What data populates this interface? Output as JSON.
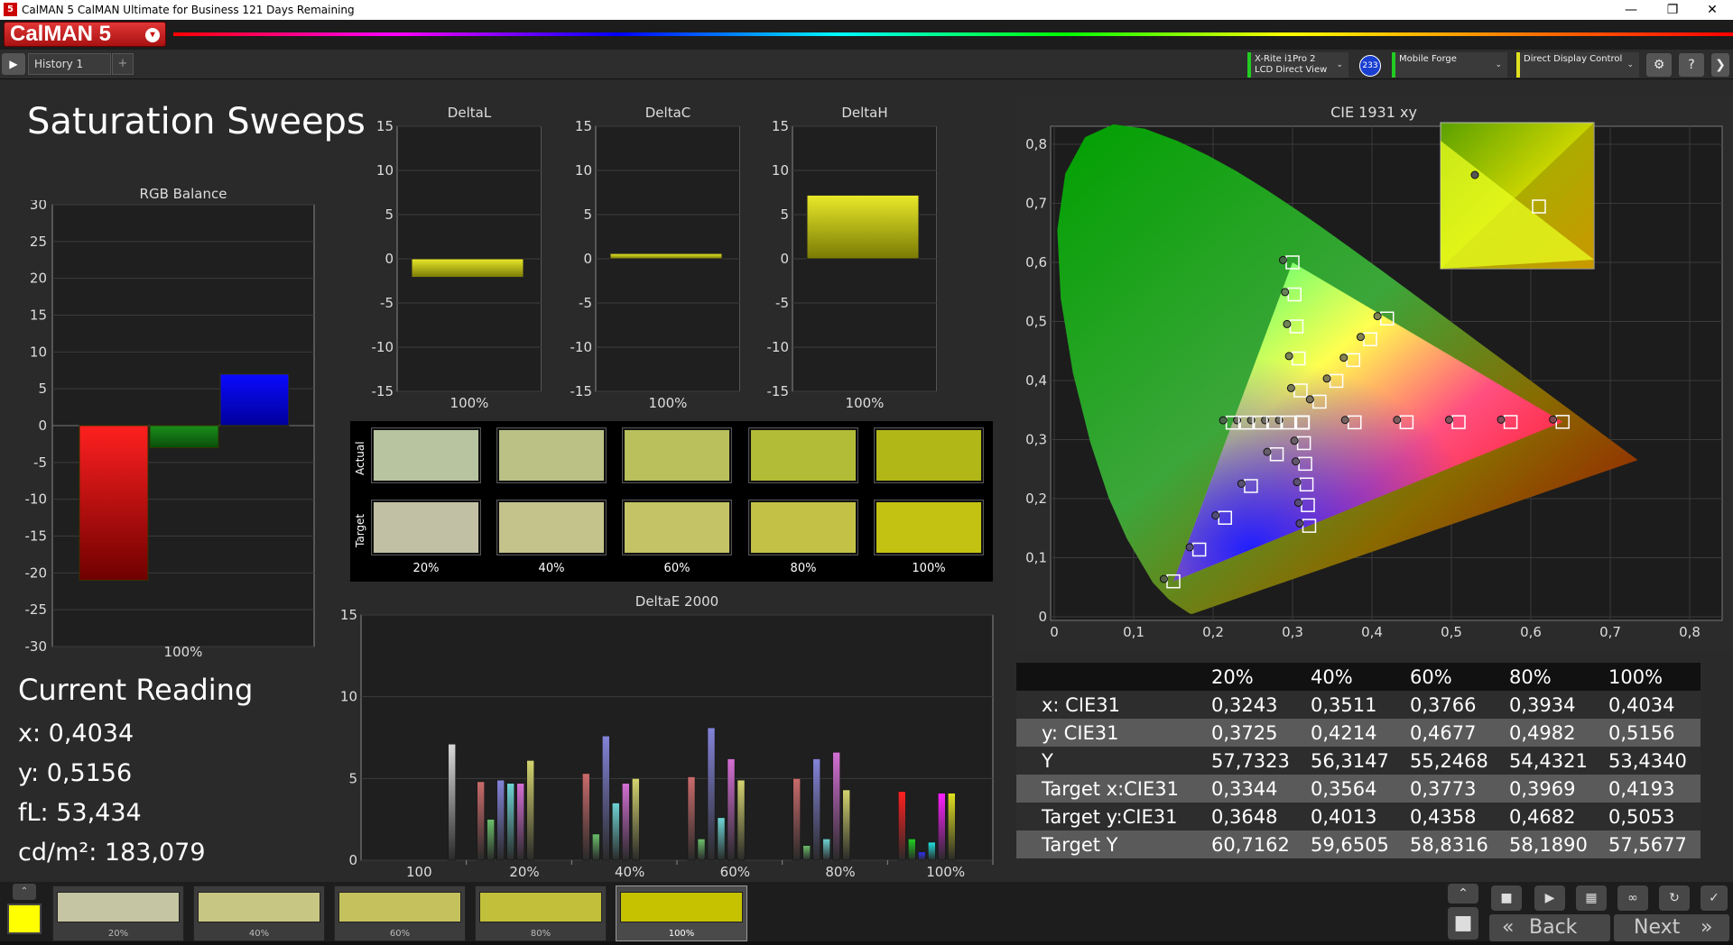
{
  "window": {
    "title": "CalMAN 5 CalMAN Ultimate for Business 121 Days Remaining",
    "app_icon": "5",
    "minimize": "—",
    "restore": "❐",
    "close": "✕"
  },
  "logo": {
    "text": "CalMAN 5",
    "menu_glyph": "▾"
  },
  "toolbar": {
    "play_glyph": "▶",
    "tab_label": "History 1",
    "add_tab_glyph": "+",
    "meter": {
      "line1": "X-Rite i1Pro 2",
      "line2": "LCD Direct View"
    },
    "meter_badge": "233",
    "source": "Mobile Forge",
    "display": "Direct Display Control",
    "chevron": "⌄",
    "settings_glyph": "⚙",
    "help_glyph": "?",
    "more_glyph": "❯",
    "accent_meter": "#2ecc2e",
    "accent_display": "#e0e020"
  },
  "page_title": "Saturation Sweeps",
  "rgb_balance": {
    "title": "RGB Balance",
    "x_label": "100%",
    "y_ticks": [
      "30",
      "25",
      "20",
      "15",
      "10",
      "5",
      "0",
      "-5",
      "-10",
      "-15",
      "-20",
      "-25",
      "-30"
    ]
  },
  "delta_small": {
    "y_ticks": [
      "15",
      "10",
      "5",
      "0",
      "-5",
      "-10",
      "-15"
    ],
    "x_label": "100%",
    "titles": [
      "DeltaL",
      "DeltaC",
      "DeltaH"
    ]
  },
  "swatches": {
    "actual_label": "Actual",
    "target_label": "Target",
    "labels": [
      "20%",
      "40%",
      "60%",
      "80%",
      "100%"
    ],
    "actual_colors": [
      "#b8c3a0",
      "#bbc184",
      "#b9c05c",
      "#b3bc36",
      "#b1b716"
    ],
    "target_colors": [
      "#c1c0a4",
      "#c4c38b",
      "#c4c365",
      "#c3c246",
      "#c3c212"
    ]
  },
  "deltae": {
    "title": "DeltaE 2000",
    "y_ticks": [
      "15",
      "10",
      "5",
      "0"
    ],
    "x_ticks": [
      "100",
      "20%",
      "40%",
      "60%",
      "80%",
      "100%"
    ]
  },
  "cie": {
    "title": "CIE 1931 xy",
    "x_ticks": [
      "0",
      "0,1",
      "0,2",
      "0,3",
      "0,4",
      "0,5",
      "0,6",
      "0,7",
      "0,8"
    ],
    "y_ticks": [
      "0,8",
      "0,7",
      "0,6",
      "0,5",
      "0,4",
      "0,3",
      "0,2",
      "0,1",
      "0"
    ]
  },
  "current": {
    "title": "Current Reading",
    "x": "x: 0,4034",
    "y": "y: 0,5156",
    "fl": "fL: 53,434",
    "cdm2": "cd/m²: 183,079"
  },
  "table": {
    "headers": [
      "",
      "20%",
      "40%",
      "60%",
      "80%",
      "100%"
    ],
    "rows": [
      [
        "x: CIE31",
        "0,3243",
        "0,3511",
        "0,3766",
        "0,3934",
        "0,4034"
      ],
      [
        "y: CIE31",
        "0,3725",
        "0,4214",
        "0,4677",
        "0,4982",
        "0,5156"
      ],
      [
        "Y",
        "57,7323",
        "56,3147",
        "55,2468",
        "54,4321",
        "53,4340"
      ],
      [
        "Target x:CIE31",
        "0,3344",
        "0,3564",
        "0,3773",
        "0,3969",
        "0,4193"
      ],
      [
        "Target y:CIE31",
        "0,3648",
        "0,4013",
        "0,4358",
        "0,4682",
        "0,5053"
      ],
      [
        "Target Y",
        "60,7162",
        "59,6505",
        "58,8316",
        "58,1890",
        "57,5677"
      ]
    ]
  },
  "bottom": {
    "current_color": "#ffff00",
    "up_glyph": "⌃",
    "steps": [
      {
        "label": "20%",
        "color": "#c5c5a3"
      },
      {
        "label": "40%",
        "color": "#c8c683"
      },
      {
        "label": "60%",
        "color": "#c5c25d"
      },
      {
        "label": "80%",
        "color": "#c2c03a"
      },
      {
        "label": "100%",
        "color": "#c6c200"
      }
    ],
    "stop_glyph": "■",
    "play_glyph": "▶",
    "loop_glyph": "∞",
    "film_glyph": "▦",
    "refresh_glyph": "↻",
    "back_label": "Back",
    "next_label": "Next",
    "back_glyph": "«",
    "next_glyph": "»",
    "check_glyph": "✓"
  }
}
